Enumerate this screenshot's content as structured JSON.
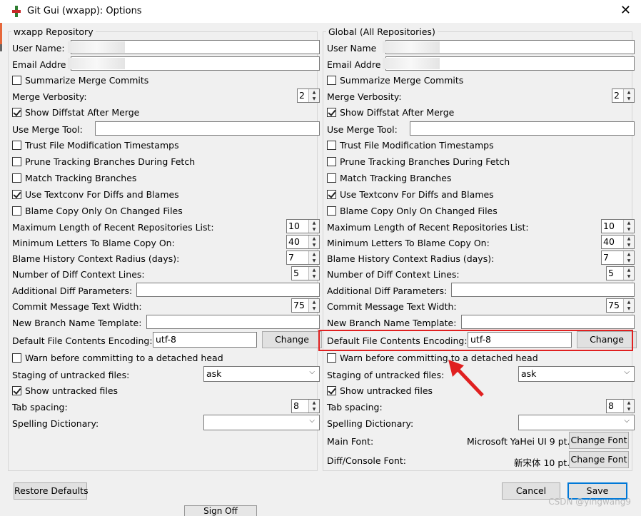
{
  "window": {
    "title": "Git Gui (wxapp): Options",
    "close_glyph": "✕"
  },
  "repo": {
    "group_label": "wxapp Repository",
    "user_name_label": "User Name:",
    "email_label": "Email Addre",
    "summarize": "Summarize Merge Commits",
    "merge_verbosity": "Merge Verbosity:",
    "merge_verbosity_val": "2",
    "show_diffstat": "Show Diffstat After Merge",
    "merge_tool": "Use Merge Tool:",
    "trust_mtime": "Trust File Modification Timestamps",
    "prune": "Prune Tracking Branches During Fetch",
    "match_tracking": "Match Tracking Branches",
    "textconv": "Use Textconv For Diffs and Blames",
    "blame_copy": "Blame Copy Only On Changed Files",
    "max_recent": "Maximum Length of Recent Repositories List:",
    "max_recent_val": "10",
    "min_letters": "Minimum Letters To Blame Copy On:",
    "min_letters_val": "40",
    "blame_radius": "Blame History Context Radius (days):",
    "blame_radius_val": "7",
    "diff_context": "Number of Diff Context Lines:",
    "diff_context_val": "5",
    "additional_diff": "Additional Diff Parameters:",
    "commit_width": "Commit Message Text Width:",
    "commit_width_val": "75",
    "branch_template": "New Branch Name Template:",
    "encoding_label": "Default File Contents Encoding:",
    "encoding_val": "utf-8",
    "change": "Change",
    "warn_detached": "Warn before committing to a detached head",
    "staging_label": "Staging of untracked files:",
    "staging_val": "ask",
    "show_untracked": "Show untracked files",
    "tab_spacing": "Tab spacing:",
    "tab_spacing_val": "8",
    "spelling": "Spelling Dictionary:"
  },
  "global": {
    "group_label": "Global (All Repositories)",
    "user_name_label": "User Name",
    "email_label": "Email Addre",
    "main_font_label": "Main Font:",
    "main_font_val": "Microsoft YaHei UI 9 pt.",
    "diff_font_label": "Diff/Console Font:",
    "diff_font_val": "新宋体 10 pt.",
    "change_font": "Change Font"
  },
  "footer": {
    "restore": "Restore Defaults",
    "cancel": "Cancel",
    "save": "Save",
    "sign_off": "Sign Off"
  },
  "watermark": "CSDN @yingwang9",
  "colors": {
    "highlight": "#e02020",
    "accent": "#0078d7"
  }
}
